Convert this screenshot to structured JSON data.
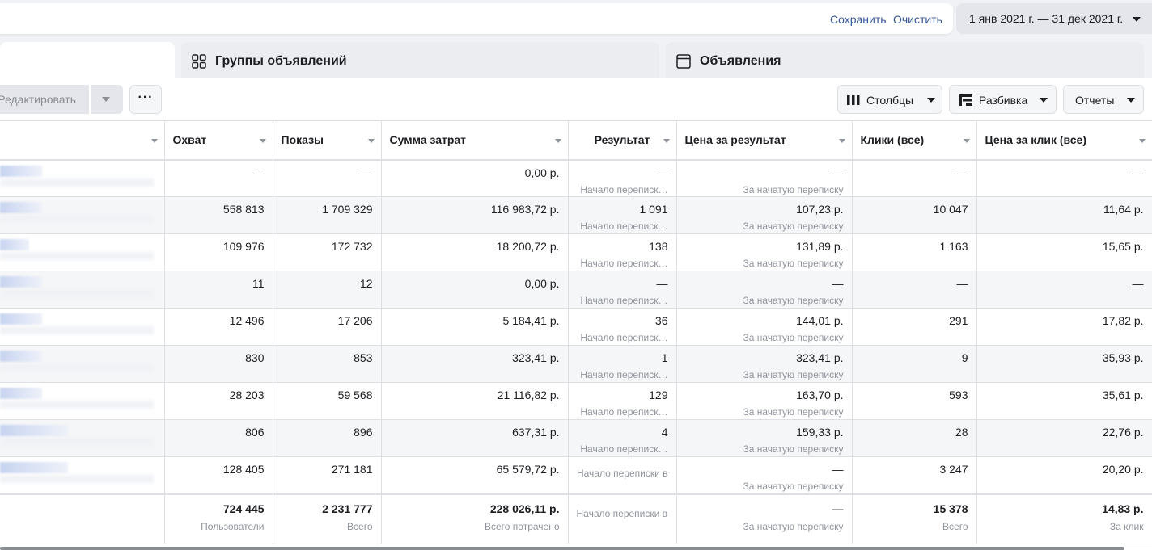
{
  "topbar": {
    "save_label": "Сохранить",
    "clear_label": "Очистить",
    "date_range": "1 янв 2021 г. — 31 дек 2021 г."
  },
  "tabs": {
    "adsets": "Группы объявлений",
    "ads": "Объявления"
  },
  "toolbar": {
    "edit_label": "Редактировать",
    "more_label": "···",
    "columns_label": "Столбцы",
    "breakdown_label": "Разбивка",
    "reports_label": "Отчеты"
  },
  "columns": [
    "Охват",
    "Показы",
    "Сумма затрат",
    "Результат",
    "Цена за результат",
    "Клики (все)",
    "Цена за клик (все)"
  ],
  "rows": [
    {
      "reach": "—",
      "impressions": "—",
      "spend": "0,00 р.",
      "result": "—",
      "result_sub": "Начало переписк…",
      "cpr": "—",
      "cpr_sub": "За начатую переписку",
      "clicks": "—",
      "cpc": "—"
    },
    {
      "reach": "558 813",
      "impressions": "1 709 329",
      "spend": "116 983,72 р.",
      "result": "1 091",
      "result_sub": "Начало переписк…",
      "cpr": "107,23 р.",
      "cpr_sub": "За начатую переписку",
      "clicks": "10 047",
      "cpc": "11,64 р."
    },
    {
      "reach": "109 976",
      "impressions": "172 732",
      "spend": "18 200,72 р.",
      "result": "138",
      "result_sub": "Начало переписк…",
      "cpr": "131,89 р.",
      "cpr_sub": "За начатую переписку",
      "clicks": "1 163",
      "cpc": "15,65 р."
    },
    {
      "reach": "11",
      "impressions": "12",
      "spend": "0,00 р.",
      "result": "—",
      "result_sub": "Начало переписк…",
      "cpr": "—",
      "cpr_sub": "За начатую переписку",
      "clicks": "—",
      "cpc": "—"
    },
    {
      "reach": "12 496",
      "impressions": "17 206",
      "spend": "5 184,41 р.",
      "result": "36",
      "result_sub": "Начало переписк…",
      "cpr": "144,01 р.",
      "cpr_sub": "За начатую переписку",
      "clicks": "291",
      "cpc": "17,82 р."
    },
    {
      "reach": "830",
      "impressions": "853",
      "spend": "323,41 р.",
      "result": "1",
      "result_sub": "Начало переписк…",
      "cpr": "323,41 р.",
      "cpr_sub": "За начатую переписку",
      "clicks": "9",
      "cpc": "35,93 р."
    },
    {
      "reach": "28 203",
      "impressions": "59 568",
      "spend": "21 116,82 р.",
      "result": "129",
      "result_sub": "Начало переписк…",
      "cpr": "163,70 р.",
      "cpr_sub": "За начатую переписку",
      "clicks": "593",
      "cpc": "35,61 р."
    },
    {
      "reach": "806",
      "impressions": "896",
      "spend": "637,31 р.",
      "result": "4",
      "result_sub": "Начало переписк…",
      "cpr": "159,33 р.",
      "cpr_sub": "За начатую переписку",
      "clicks": "28",
      "cpc": "22,76 р."
    },
    {
      "reach": "128 405",
      "impressions": "271 181",
      "spend": "65 579,72 р.",
      "result": "",
      "result_sub": "Начало переписки в",
      "cpr": "—",
      "cpr_sub": "За начатую переписку",
      "clicks": "3 247",
      "cpc": "20,20 р."
    }
  ],
  "totals": {
    "reach": "724 445",
    "reach_sub": "Пользователи",
    "impressions": "2 231 777",
    "impressions_sub": "Всего",
    "spend": "228 026,11 р.",
    "spend_sub": "Всего потрачено",
    "result": "",
    "result_sub": "Начало переписки в г",
    "cpr": "—",
    "cpr_sub": "За начатую переписку",
    "clicks": "15 378",
    "clicks_sub": "Всего",
    "cpc": "14,83 р.",
    "cpc_sub": "За клик"
  }
}
